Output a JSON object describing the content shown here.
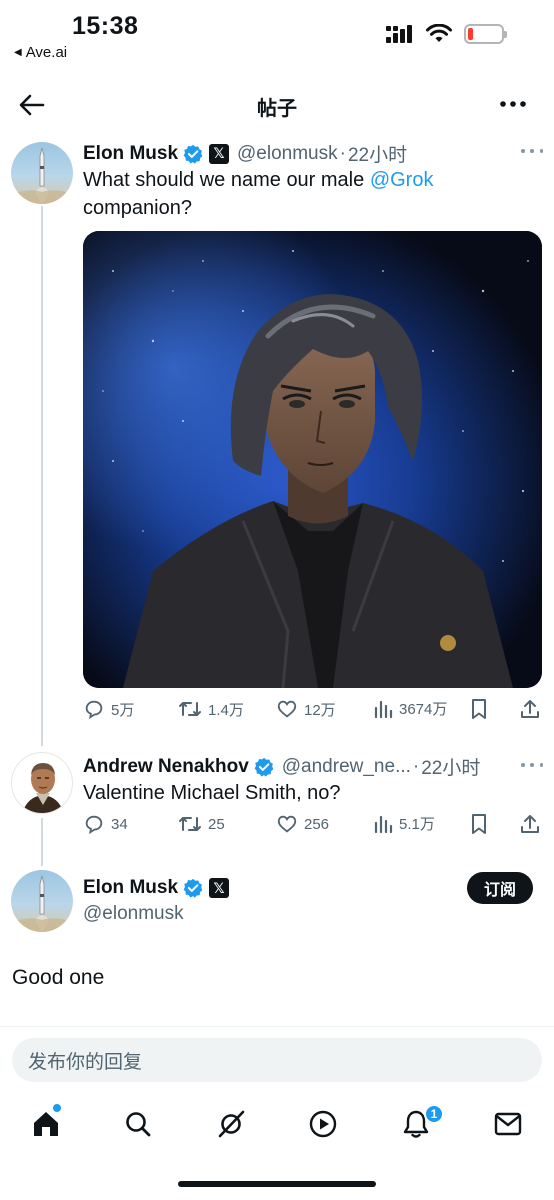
{
  "status_bar": {
    "time": "15:38",
    "back_app": "Ave.ai",
    "battery_level": 0.15,
    "battery_color": "#ff3b30"
  },
  "header": {
    "title": "帖子",
    "back_icon": "arrow-left-icon",
    "more_icon": "more-horizontal-icon"
  },
  "tweets": [
    {
      "name": "Elon Musk",
      "handle": "@elonmusk",
      "time": "22小时",
      "text_before": "What should we name our male ",
      "mention": "@Grok",
      "text_after": "companion?",
      "actions": {
        "replies": "5万",
        "retweets": "1.4万",
        "likes": "12万",
        "views": "3674万"
      }
    },
    {
      "name": "Andrew Nenakhov",
      "handle": "@andrew_ne...",
      "time": "22小时",
      "text": "Valentine Michael Smith, no?",
      "actions": {
        "replies": "34",
        "retweets": "25",
        "likes": "256",
        "views": "5.1万"
      }
    },
    {
      "name": "Elon Musk",
      "handle": "@elonmusk",
      "subscribe_label": "订阅",
      "text": "Good one"
    }
  ],
  "reply_box": {
    "placeholder": "发布你的回复"
  },
  "tabbar": {
    "items": [
      "home-icon",
      "search-icon",
      "grok-icon",
      "video-icon",
      "notifications-icon",
      "messages-icon"
    ],
    "notification_count": "1"
  },
  "colors": {
    "accent": "#1d9bf0",
    "text": "#0f1419",
    "secondary_text": "#536471"
  }
}
